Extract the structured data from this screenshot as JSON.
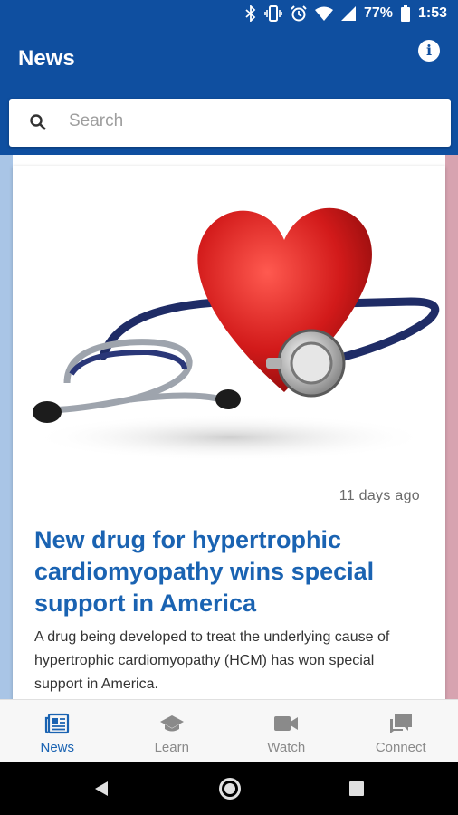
{
  "status_bar": {
    "battery": "77%",
    "time": "1:53",
    "icons": [
      "bluetooth-icon",
      "vibrate-icon",
      "alarm-icon",
      "wifi-icon",
      "signal-icon",
      "battery-icon"
    ]
  },
  "app_bar": {
    "title": "News",
    "info_icon": "info-icon"
  },
  "search": {
    "placeholder": "Search",
    "value": ""
  },
  "article": {
    "image_desc_icon": "heart-stethoscope-image",
    "date": "11 days ago",
    "headline": "New drug for hypertrophic cardiomyopathy wins special support in America",
    "summary": "A drug being developed to treat the underlying cause of hypertrophic cardiomyopathy (HCM) has won special support in America."
  },
  "bottom_nav": {
    "items": [
      {
        "label": "News",
        "icon": "newspaper-icon",
        "active": true
      },
      {
        "label": "Learn",
        "icon": "graduation-cap-icon",
        "active": false
      },
      {
        "label": "Watch",
        "icon": "video-camera-icon",
        "active": false
      },
      {
        "label": "Connect",
        "icon": "chat-icon",
        "active": false
      }
    ]
  },
  "colors": {
    "primary": "#0f4fa0",
    "headline": "#1a63b2",
    "active_nav": "#1a63b2",
    "inactive_nav": "#8a8a8a"
  }
}
